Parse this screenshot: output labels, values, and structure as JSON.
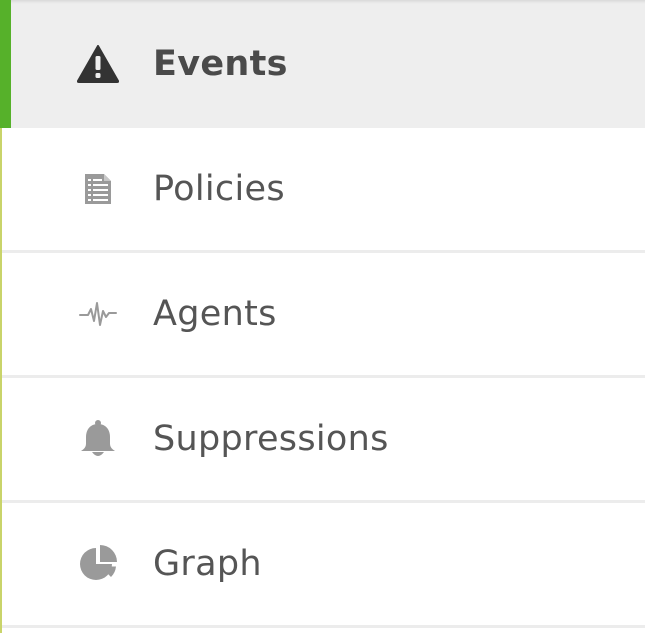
{
  "nav": {
    "items": [
      {
        "label": "Events",
        "icon": "warning-icon",
        "active": true
      },
      {
        "label": "Policies",
        "icon": "document-list-icon",
        "active": false
      },
      {
        "label": "Agents",
        "icon": "pulse-icon",
        "active": false
      },
      {
        "label": "Suppressions",
        "icon": "bell-icon",
        "active": false
      },
      {
        "label": "Graph",
        "icon": "pie-chart-icon",
        "active": false
      }
    ]
  },
  "colors": {
    "active_indicator": "#56b12a",
    "active_background": "#eeeeee",
    "icon_active": "#333333",
    "icon_inactive": "#9a9a9a",
    "label": "#555555"
  }
}
